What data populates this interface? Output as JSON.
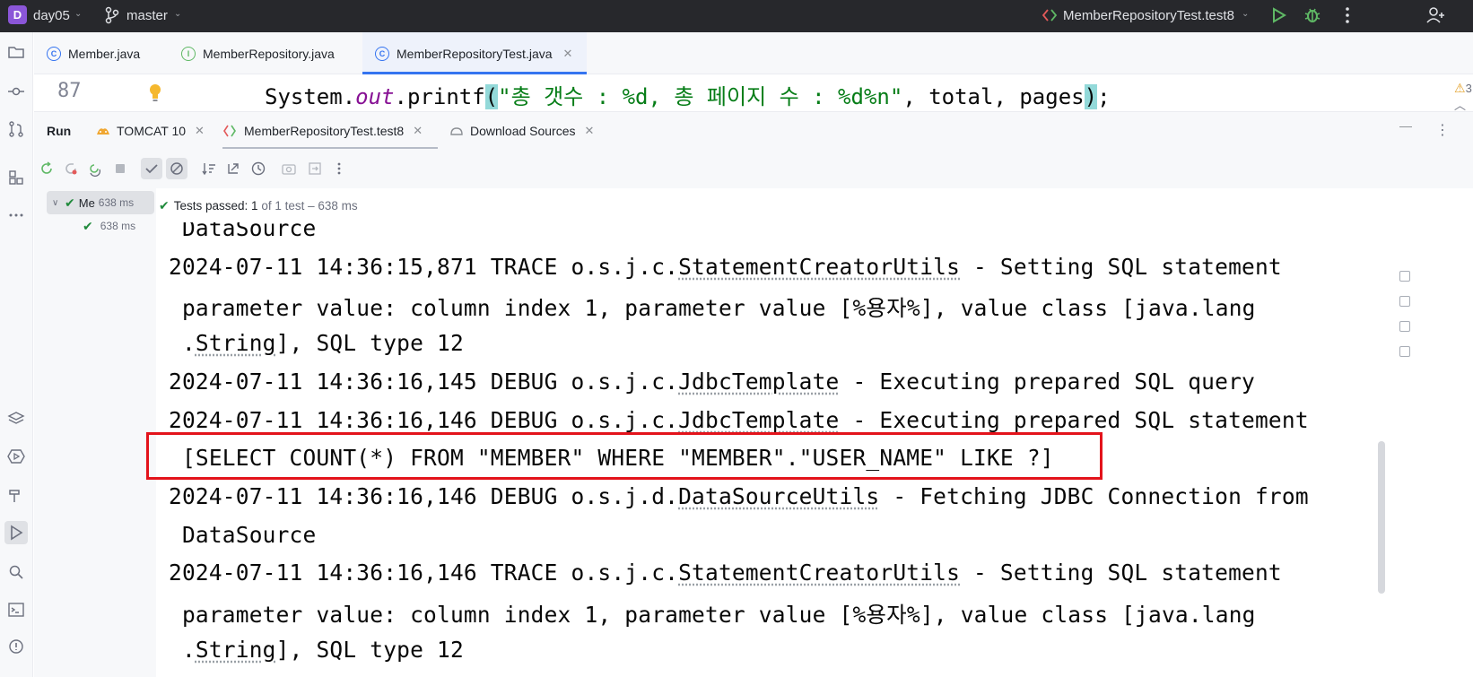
{
  "titlebar": {
    "project_initial": "D",
    "project_name": "day05",
    "branch": "master",
    "run_config": "MemberRepositoryTest.test8"
  },
  "editor_tabs": [
    {
      "label": "Member.java",
      "icon": "class-icon"
    },
    {
      "label": "MemberRepository.java",
      "icon": "interface-icon"
    },
    {
      "label": "MemberRepositoryTest.java",
      "icon": "test-class-icon",
      "active": true
    }
  ],
  "editor": {
    "line_number": "87",
    "code_prefix": "System.",
    "code_field": "out",
    "code_method": ".printf",
    "code_open": "(",
    "code_string": "\"총 갯수 : %d, 총 페이지 수 : %d%n\"",
    "code_args": ", total, pages",
    "code_close": ")",
    "code_end": ";",
    "warnings_count": "3"
  },
  "run": {
    "title": "Run",
    "tabs": [
      {
        "label": "TOMCAT 10"
      },
      {
        "label": "MemberRepositoryTest.test8",
        "active": true
      },
      {
        "label": "Download Sources"
      }
    ]
  },
  "test_tree": {
    "root_name": "Me",
    "root_time": "638 ms",
    "child_time": "638 ms"
  },
  "status": {
    "label": "Tests passed:",
    "passed": "1",
    "rest": "of 1 test – 638 ms"
  },
  "console": {
    "lines": [
      {
        "pre": " DataSource",
        "u": "",
        "post": ""
      },
      {
        "pre": "2024-07-11 14:36:15,871 TRACE o.s.j.c.",
        "u": "StatementCreatorUtils",
        "post": " - Setting SQL statement"
      },
      {
        "pre": " parameter value: column index 1, parameter value [%용자%], value class [java.lang",
        "u": "",
        "post": ""
      },
      {
        "pre": " .",
        "u": "String",
        "post": "], SQL type 12"
      },
      {
        "pre": "2024-07-11 14:36:16,145 DEBUG o.s.j.c.",
        "u": "JdbcTemplate",
        "post": " - Executing prepared SQL query"
      },
      {
        "pre": "2024-07-11 14:36:16,146 DEBUG o.s.j.c.",
        "u": "JdbcTemplate",
        "post": " - Executing prepared SQL statement"
      },
      {
        "pre": " [SELECT COUNT(*) FROM \"MEMBER\" WHERE \"MEMBER\".\"USER_NAME\" LIKE ?]",
        "u": "",
        "post": ""
      },
      {
        "pre": "2024-07-11 14:36:16,146 DEBUG o.s.j.d.",
        "u": "DataSourceUtils",
        "post": " - Fetching JDBC Connection from"
      },
      {
        "pre": " DataSource",
        "u": "",
        "post": ""
      },
      {
        "pre": "2024-07-11 14:36:16,146 TRACE o.s.j.c.",
        "u": "StatementCreatorUtils",
        "post": " - Setting SQL statement"
      },
      {
        "pre": " parameter value: column index 1, parameter value [%용자%], value class [java.lang",
        "u": "",
        "post": ""
      },
      {
        "pre": " .",
        "u": "String",
        "post": "], SQL type 12"
      }
    ]
  },
  "colors": {
    "accent": "#3574f0",
    "pass_green": "#208a3c",
    "highlight_red": "#e3131b"
  }
}
